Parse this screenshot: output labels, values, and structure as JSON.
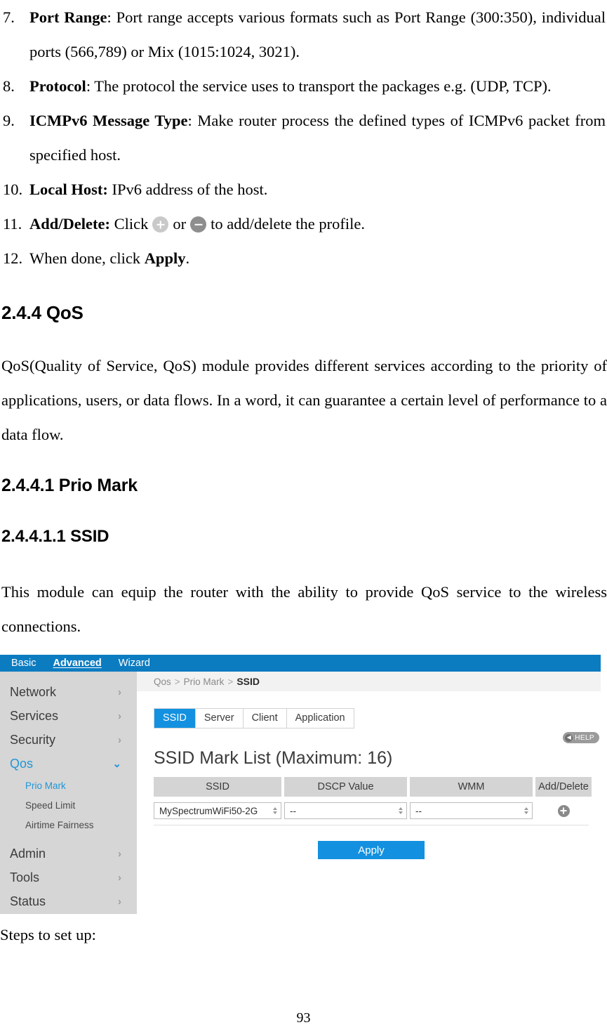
{
  "document": {
    "list_items": [
      {
        "number": "7.",
        "term": "Port Range",
        "sep": ": ",
        "text": "Port range accepts various formats such as Port Range (300:350), individual ports (566,789) or Mix (1015:1024, 3021)."
      },
      {
        "number": "8.",
        "term": "Protocol",
        "sep": ": ",
        "text": "The protocol the service uses to transport the packages e.g. (UDP, TCP)."
      },
      {
        "number": "9.",
        "term": "ICMPv6 Message Type",
        "sep": ": ",
        "text": "Make router process the defined types of ICMPv6 packet from specified host."
      },
      {
        "number": "10.",
        "term": "Local Host:",
        "sep": " ",
        "text": "IPv6 address of the host."
      },
      {
        "number": "11.",
        "term": "Add/Delete:",
        "sep": " ",
        "text_before": "Click",
        "text_middle": "or",
        "text_after": "to add/delete the profile.",
        "icon_add": "plus-circle-icon",
        "icon_delete": "minus-circle-icon"
      },
      {
        "number": "12.",
        "term": "",
        "text_before": "When done, click ",
        "term_bold": "Apply",
        "text_after": "."
      }
    ],
    "heading_qos": "2.4.4 QoS",
    "para_qos": "QoS(Quality of Service, QoS) module provides different services according to the priority of applications, users, or data flows. In a word, it can guarantee a certain level of performance to a data flow.",
    "heading_prio_mark": "2.4.4.1 Prio Mark",
    "heading_ssid": "2.4.4.1.1 SSID",
    "para_ssid": "This module can equip the router with the ability to provide QoS service to the wireless connections.",
    "steps_caption": "Steps to set up:",
    "page_number": "93"
  },
  "screenshot": {
    "topnav": {
      "items": [
        {
          "label": "Basic",
          "active": false
        },
        {
          "label": "Advanced",
          "active": true
        },
        {
          "label": "Wizard",
          "active": false
        }
      ]
    },
    "sidebar": {
      "items": [
        {
          "label": "Network",
          "chevron": "›",
          "active": false
        },
        {
          "label": "Services",
          "chevron": "›",
          "active": false
        },
        {
          "label": "Security",
          "chevron": "›",
          "active": false
        },
        {
          "label": "Qos",
          "chevron": "⌄",
          "active": true
        }
      ],
      "sub_items": [
        {
          "label": "Prio Mark",
          "active": true
        },
        {
          "label": "Speed Limit",
          "active": false
        },
        {
          "label": "Airtime Fairness",
          "active": false
        }
      ],
      "items_bottom": [
        {
          "label": "Admin",
          "chevron": "›",
          "active": false
        },
        {
          "label": "Tools",
          "chevron": "›",
          "active": false
        },
        {
          "label": "Status",
          "chevron": "›",
          "active": false
        }
      ]
    },
    "breadcrumb": {
      "root": "Qos",
      "sep1": ">",
      "mid": "Prio Mark",
      "sep2": ">",
      "current": "SSID"
    },
    "tabs": [
      {
        "label": "SSID",
        "active": true
      },
      {
        "label": "Server",
        "active": false
      },
      {
        "label": "Client",
        "active": false
      },
      {
        "label": "Application",
        "active": false
      }
    ],
    "help_button": {
      "label": "HELP",
      "arrow_glyph": "◀"
    },
    "panel": {
      "title": "SSID Mark List (Maximum: 16)",
      "columns": [
        "SSID",
        "DSCP Value",
        "WMM",
        "Add/Delete"
      ],
      "rows": [
        {
          "ssid": "MySpectrumWiFi50-2G",
          "dscp": "--",
          "wmm": "--",
          "action": "add-icon"
        }
      ],
      "apply_label": "Apply"
    },
    "colors": {
      "topbar_blue": "#0c7cc1",
      "accent_blue": "#1391e0",
      "link_blue": "#2196d6",
      "sidebar_gray": "#d6d6d6",
      "header_cell_gray": "#d4d4d4",
      "breadcrumb_bg": "#f2f2f2"
    }
  }
}
